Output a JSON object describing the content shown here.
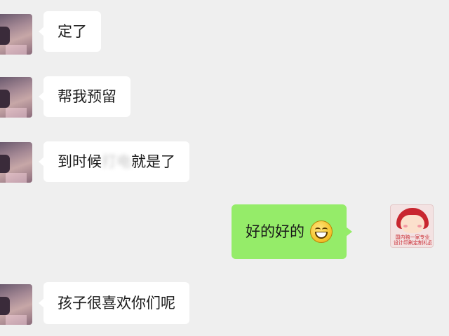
{
  "messages": [
    {
      "side": "left",
      "text": "定了"
    },
    {
      "side": "left",
      "text": "帮我预留"
    },
    {
      "side": "left",
      "text_before": "到时候",
      "text_blurred": "打电",
      "text_after": "就是了"
    },
    {
      "side": "right",
      "text": "好的好的",
      "emoji": "grinning-face-icon"
    },
    {
      "side": "left",
      "text": "孩子很喜欢你们呢"
    }
  ],
  "self_avatar": {
    "caption_line1": "国内独一家专业",
    "caption_line2": "设计印刷定制礼品"
  },
  "colors": {
    "background": "#efefef",
    "incoming_bubble": "#ffffff",
    "outgoing_bubble": "#95ec69"
  }
}
